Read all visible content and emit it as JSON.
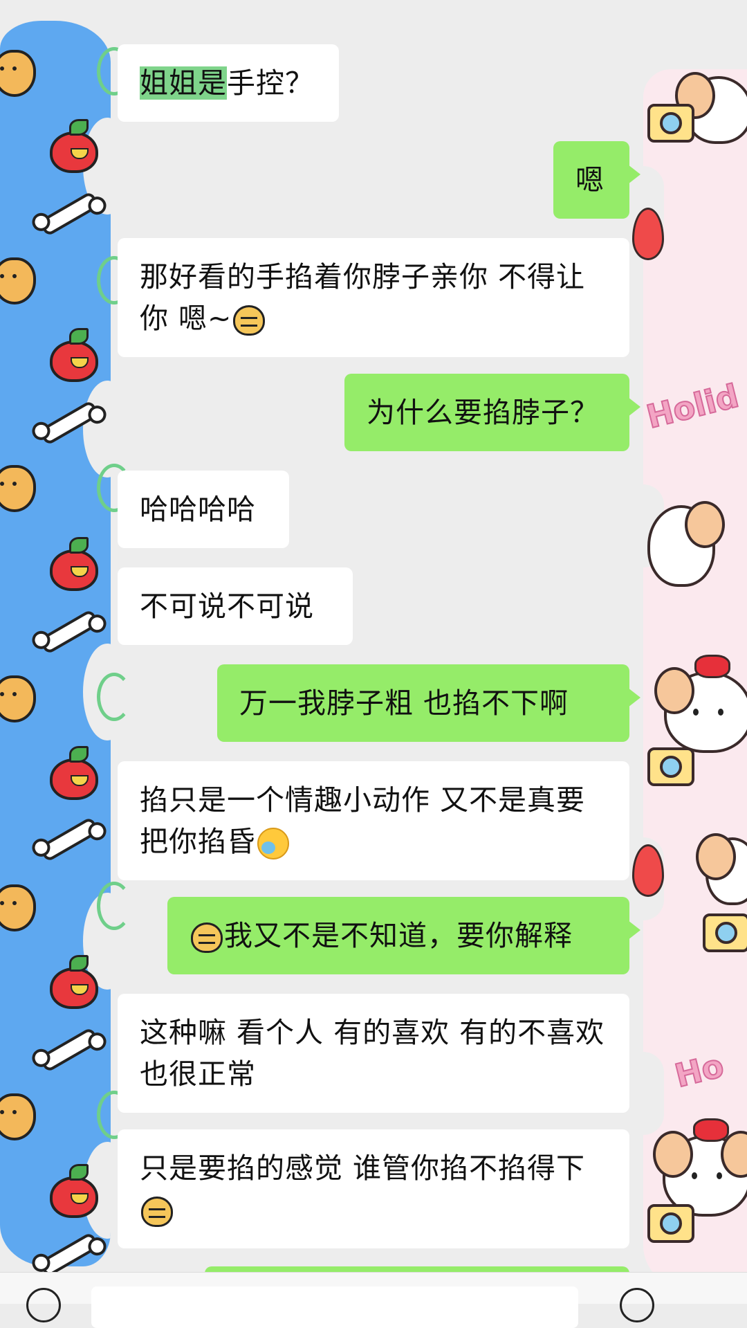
{
  "messages": [
    {
      "side": "in",
      "text_highlight": "姐姐是",
      "text": "手控？"
    },
    {
      "side": "out",
      "text": "嗯"
    },
    {
      "side": "in",
      "text": "那好看的手掐着你脖子亲你 不得让你 嗯~",
      "emoji": "doge-emoji"
    },
    {
      "side": "out",
      "text": "为什么要掐脖子？"
    },
    {
      "side": "in",
      "text": "哈哈哈哈"
    },
    {
      "side": "in",
      "text": "不可说不可说"
    },
    {
      "side": "out",
      "text": "万一我脖子粗  也掐不下啊"
    },
    {
      "side": "in",
      "text": "掐只是一个情趣小动作 又不是真要把你掐昏",
      "emoji": "facepalm-emoji"
    },
    {
      "side": "out",
      "emoji": "doge-emoji",
      "text": "我又不是不知道，要你解释"
    },
    {
      "side": "in",
      "text": "这种嘛 看个人 有的喜欢 有的不喜欢 也很正常"
    },
    {
      "side": "in",
      "text": "只是要掐的感觉 谁管你掐不掐得下",
      "emoji": "doge-emoji"
    }
  ],
  "decorations": {
    "right_sticker_text": "Holid",
    "right_sticker_text_2": "Ho"
  },
  "colors": {
    "background": "#ededed",
    "bubble_in": "#ffffff",
    "bubble_out": "#95ec69",
    "highlight": "#7fd48b",
    "left_strip": "#5ea8f0",
    "right_strip": "#fbe9ee"
  },
  "input_bar": {
    "voice_icon": "voice-icon",
    "emoji_icon": "emoji-icon"
  }
}
